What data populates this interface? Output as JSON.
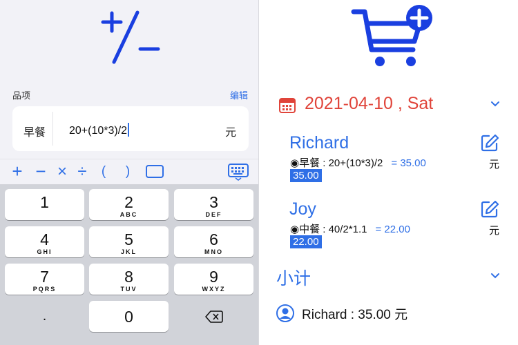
{
  "calculator": {
    "operator_glyph": "plus-minus-icon",
    "section_label": "品项",
    "edit_label": "编辑",
    "meal_label": "早餐",
    "expression_value": "20+(10*3)/2",
    "unit_label": "元"
  },
  "toolbar": {
    "items": [
      {
        "name": "plus-tool",
        "label": "+"
      },
      {
        "name": "minus-tool",
        "label": "−"
      },
      {
        "name": "times-tool",
        "label": "×"
      },
      {
        "name": "divide-tool",
        "label": "÷"
      },
      {
        "name": "open-paren-tool",
        "label": "("
      },
      {
        "name": "close-paren-tool",
        "label": ")"
      }
    ]
  },
  "keypad": {
    "keys": [
      {
        "num": "1",
        "sub": ""
      },
      {
        "num": "2",
        "sub": "ABC"
      },
      {
        "num": "3",
        "sub": "DEF"
      },
      {
        "num": "4",
        "sub": "GHI"
      },
      {
        "num": "5",
        "sub": "JKL"
      },
      {
        "num": "6",
        "sub": "MNO"
      },
      {
        "num": "7",
        "sub": "PQRS"
      },
      {
        "num": "8",
        "sub": "TUV"
      },
      {
        "num": "9",
        "sub": "WXYZ"
      },
      {
        "num": ".",
        "sub": ""
      },
      {
        "num": "0",
        "sub": ""
      }
    ]
  },
  "order": {
    "date": "2021-04-10 , Sat",
    "people": [
      {
        "name": "Richard",
        "entry": "◉早餐 : 20+(10*3)/2",
        "result": "= 35.00",
        "total": "35.00",
        "unit": "元"
      },
      {
        "name": "Joy",
        "entry": "◉中餐 : 40/2*1.1",
        "result": "= 22.00",
        "total": "22.00",
        "unit": "元"
      }
    ],
    "subtotal_title": "小计",
    "summary_line": "Richard : 35.00 元"
  },
  "colors": {
    "accent": "#2f6fe6",
    "date_red": "#e0443a",
    "logo_blue": "#1a3fe0"
  }
}
